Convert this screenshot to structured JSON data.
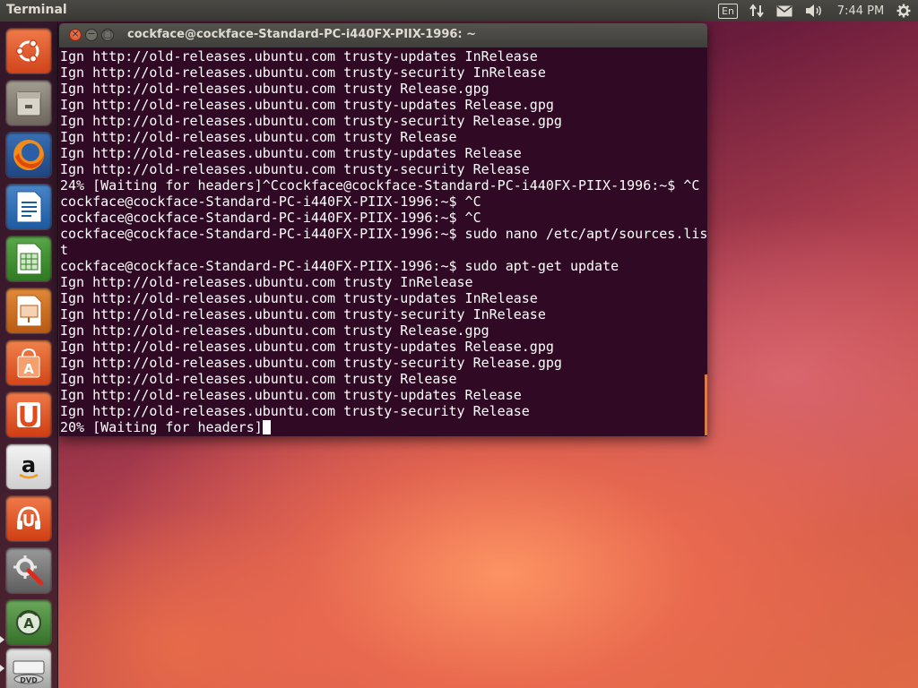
{
  "panel": {
    "app_title": "Terminal",
    "keyboard_layout": "En",
    "clock": "7:44 PM"
  },
  "launcher": {
    "items": [
      {
        "name": "dash-home",
        "icon": "ubuntu-logo-icon",
        "color": "#e95420"
      },
      {
        "name": "files",
        "icon": "file-cabinet-icon",
        "color": "#8a8378"
      },
      {
        "name": "firefox",
        "icon": "firefox-icon",
        "color": "#e66000"
      },
      {
        "name": "libreoffice-writer",
        "icon": "document-icon",
        "color": "#2a6bb5"
      },
      {
        "name": "libreoffice-calc",
        "icon": "spreadsheet-icon",
        "color": "#3b8a2e"
      },
      {
        "name": "libreoffice-impress",
        "icon": "presentation-icon",
        "color": "#c4641f"
      },
      {
        "name": "ubuntu-software-center",
        "icon": "shopping-bag-icon",
        "color": "#e45a1e"
      },
      {
        "name": "ubuntu-one",
        "icon": "u-letter-icon",
        "color": "#e24b1a"
      },
      {
        "name": "amazon",
        "icon": "amazon-icon",
        "color": "#f0f0f0"
      },
      {
        "name": "ubuntu-one-music",
        "icon": "headphones-icon",
        "color": "#e24b1a"
      },
      {
        "name": "system-settings",
        "icon": "wrench-gear-icon",
        "color": "#7a7a7a"
      },
      {
        "name": "software-updater",
        "icon": "updater-icon",
        "color": "#4a8a3a"
      },
      {
        "name": "dvd-drive",
        "icon": "dvd-icon",
        "color": "#d8d8d8"
      }
    ]
  },
  "window": {
    "title": "cockface@cockface-Standard-PC-i440FX-PIIX-1996: ~"
  },
  "terminal": {
    "lines": [
      "Ign http://old-releases.ubuntu.com trusty-updates InRelease",
      "Ign http://old-releases.ubuntu.com trusty-security InRelease",
      "Ign http://old-releases.ubuntu.com trusty Release.gpg",
      "Ign http://old-releases.ubuntu.com trusty-updates Release.gpg",
      "Ign http://old-releases.ubuntu.com trusty-security Release.gpg",
      "Ign http://old-releases.ubuntu.com trusty Release",
      "Ign http://old-releases.ubuntu.com trusty-updates Release",
      "Ign http://old-releases.ubuntu.com trusty-security Release",
      "24% [Waiting for headers]^Ccockface@cockface-Standard-PC-i440FX-PIIX-1996:~$ ^C",
      "cockface@cockface-Standard-PC-i440FX-PIIX-1996:~$ ^C",
      "cockface@cockface-Standard-PC-i440FX-PIIX-1996:~$ ^C",
      "cockface@cockface-Standard-PC-i440FX-PIIX-1996:~$ sudo nano /etc/apt/sources.lis",
      "t",
      "cockface@cockface-Standard-PC-i440FX-PIIX-1996:~$ sudo apt-get update",
      "Ign http://old-releases.ubuntu.com trusty InRelease",
      "Ign http://old-releases.ubuntu.com trusty-updates InRelease",
      "Ign http://old-releases.ubuntu.com trusty-security InRelease",
      "Ign http://old-releases.ubuntu.com trusty Release.gpg",
      "Ign http://old-releases.ubuntu.com trusty-updates Release.gpg",
      "Ign http://old-releases.ubuntu.com trusty-security Release.gpg",
      "Ign http://old-releases.ubuntu.com trusty Release",
      "Ign http://old-releases.ubuntu.com trusty-updates Release",
      "Ign http://old-releases.ubuntu.com trusty-security Release"
    ],
    "current_line": "20% [Waiting for headers]",
    "background": "#300a24",
    "foreground": "#ffffff"
  }
}
